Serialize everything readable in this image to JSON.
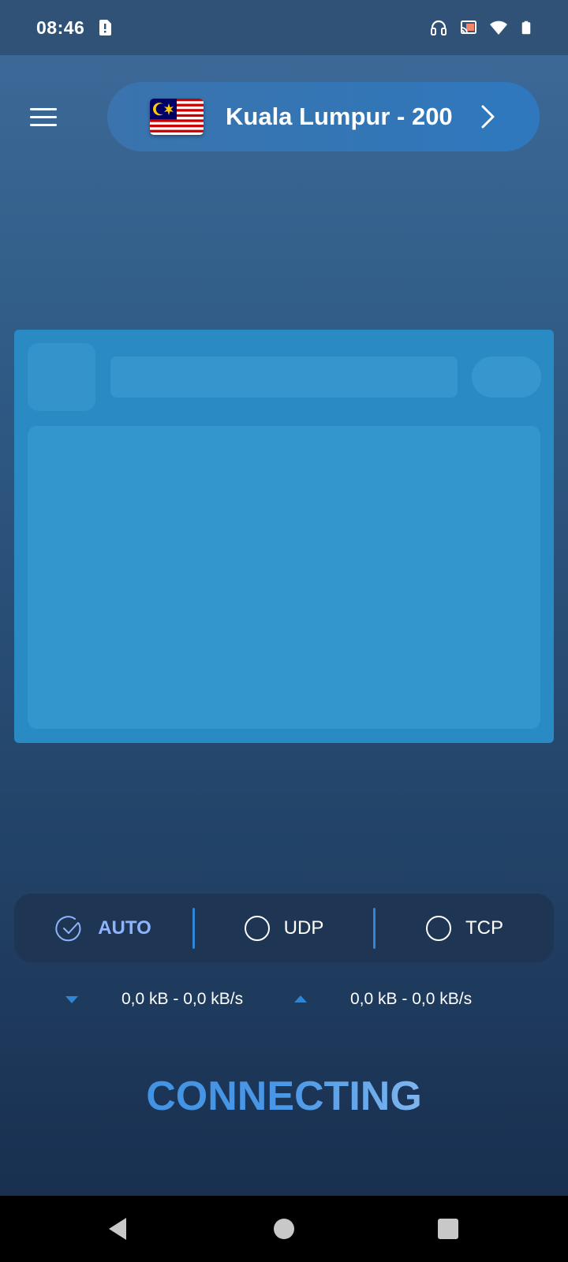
{
  "status_bar": {
    "time": "08:46",
    "icons": [
      "sim-alert-icon",
      "headphones-icon",
      "cast-icon",
      "wifi-icon",
      "battery-icon"
    ]
  },
  "header": {
    "menu_icon": "hamburger-menu-icon",
    "server": {
      "flag": "malaysia-flag-icon",
      "name": "Kuala Lumpur - 200",
      "chevron": "chevron-right-icon"
    }
  },
  "protocols": {
    "options": [
      {
        "label": "AUTO",
        "selected": true
      },
      {
        "label": "UDP",
        "selected": false
      },
      {
        "label": "TCP",
        "selected": false
      }
    ]
  },
  "traffic": {
    "download": "0,0 kB - 0,0 kB/s",
    "upload": "0,0 kB - 0,0 kB/s"
  },
  "connection": {
    "status": "CONNECTING"
  },
  "colors": {
    "accent": "#2f86d6",
    "active_label": "#8fb3ff",
    "ad_background": "#2a8ac4"
  }
}
